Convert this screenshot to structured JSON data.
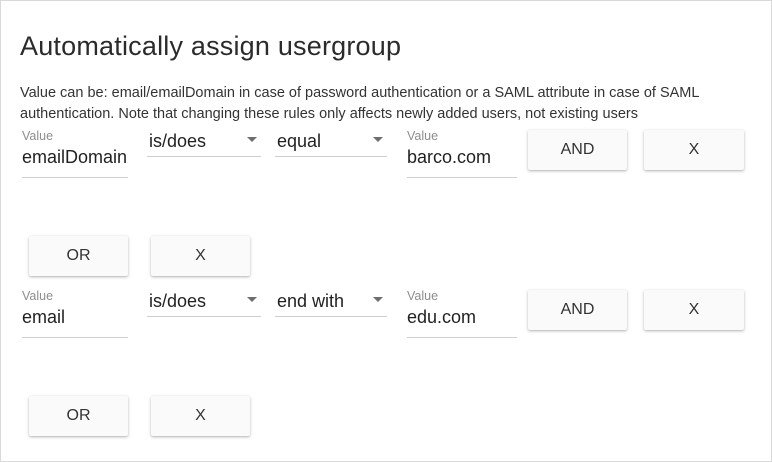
{
  "dialog": {
    "title": "Automatically assign usergroup",
    "description": "Value can be: email/emailDomain in case of password authentication or a SAML attribute in case of SAML authentication. Note that changing these rules only affects newly added users, not existing users"
  },
  "rules": [
    {
      "attribute_label": "Value",
      "attribute_value": "emailDomain",
      "operator": "is/does",
      "comparator": "equal",
      "value_label": "Value",
      "value": "barco.com",
      "and_label": "AND",
      "remove_label": "X",
      "or_label": "OR",
      "remove_group_label": "X"
    },
    {
      "attribute_label": "Value",
      "attribute_value": "email",
      "operator": "is/does",
      "comparator": "end with",
      "value_label": "Value",
      "value": "edu.com",
      "and_label": "AND",
      "remove_label": "X",
      "or_label": "OR",
      "remove_group_label": "X"
    }
  ]
}
